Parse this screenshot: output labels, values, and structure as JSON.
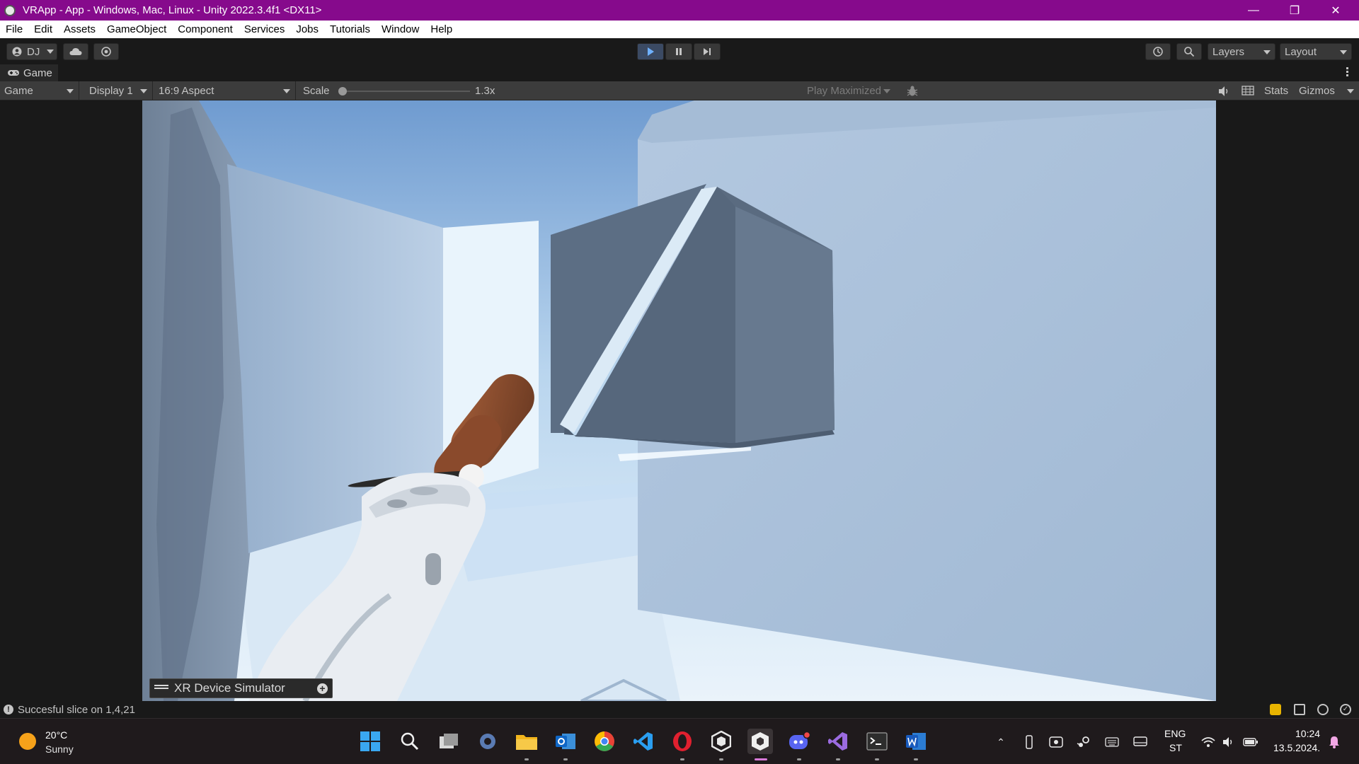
{
  "window": {
    "title": "VRApp - App - Windows, Mac, Linux - Unity 2022.3.4f1 <DX11>",
    "controls": [
      "minimize",
      "restore",
      "close"
    ]
  },
  "menu": [
    "File",
    "Edit",
    "Assets",
    "GameObject",
    "Component",
    "Services",
    "Jobs",
    "Tutorials",
    "Window",
    "Help"
  ],
  "toolbar": {
    "account_label": "DJ",
    "layers_label": "Layers",
    "layout_label": "Layout",
    "icons": [
      "account-icon",
      "cloud-icon",
      "collab-icon",
      "play-icon",
      "pause-icon",
      "step-icon",
      "history-icon",
      "search-icon"
    ]
  },
  "tab": {
    "label": "Game",
    "icon": "gamepad-icon"
  },
  "game_toolbar": {
    "view_mode": "Game",
    "display": "Display 1",
    "aspect": "16:9 Aspect",
    "scale_label": "Scale",
    "scale_value": "1.3x",
    "scale_slider_fraction": 0.0,
    "play_mode": "Play Maximized",
    "stats_label": "Stats",
    "gizmos_label": "Gizmos"
  },
  "xr_simulator": {
    "label": "XR Device Simulator"
  },
  "status": {
    "message": "Succesful slice on 1,4,21"
  },
  "taskbar": {
    "weather": {
      "temp": "20°C",
      "condition": "Sunny"
    },
    "apps": [
      "start-icon",
      "search-icon",
      "task-view-icon",
      "settings-icon",
      "file-explorer-icon",
      "outlook-icon",
      "chrome-icon",
      "vscode-icon",
      "opera-icon",
      "unity-hub-icon",
      "unity-icon",
      "discord-icon",
      "visual-studio-icon",
      "terminal-icon",
      "word-icon"
    ],
    "language": {
      "line1": "ENG",
      "line2": "ST"
    },
    "clock": {
      "time": "10:24",
      "date": "13.5.2024."
    }
  },
  "colors": {
    "titlebar": "#860a8c",
    "sky": "#bcd8ef",
    "wall": "#a8bfd9",
    "cube": "#5c6e84",
    "handle": "#8a4a2c"
  }
}
